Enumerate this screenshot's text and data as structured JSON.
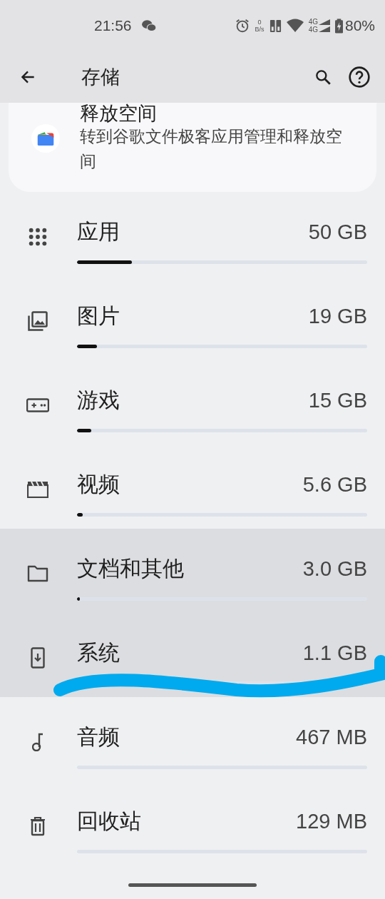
{
  "status_bar": {
    "time": "21:56",
    "net_speed_value": "0",
    "net_speed_unit": "B/s",
    "network_types": [
      "4G",
      "4G"
    ],
    "battery": "80%"
  },
  "app_bar": {
    "title": "存储"
  },
  "free_up_card": {
    "title": "释放空间",
    "description": "转到谷歌文件极客应用管理和释放空间"
  },
  "categories": [
    {
      "kind": "apps",
      "name": "应用",
      "size": "50 GB",
      "level": 0.19,
      "highlighted": false
    },
    {
      "kind": "images",
      "name": "图片",
      "size": "19 GB",
      "level": 0.07,
      "highlighted": false
    },
    {
      "kind": "games",
      "name": "游戏",
      "size": "15 GB",
      "level": 0.05,
      "highlighted": false
    },
    {
      "kind": "video",
      "name": "视频",
      "size": "5.6 GB",
      "level": 0.02,
      "highlighted": false
    },
    {
      "kind": "folder",
      "name": "文档和其他",
      "size": "3.0 GB",
      "level": 0.01,
      "highlighted": true
    },
    {
      "kind": "system",
      "name": "系统",
      "size": "1.1 GB",
      "highlighted": true
    },
    {
      "kind": "audio",
      "name": "音频",
      "size": "467 MB",
      "highlighted": false
    },
    {
      "kind": "trash",
      "name": "回收站",
      "size": "129 MB",
      "highlighted": false
    }
  ]
}
